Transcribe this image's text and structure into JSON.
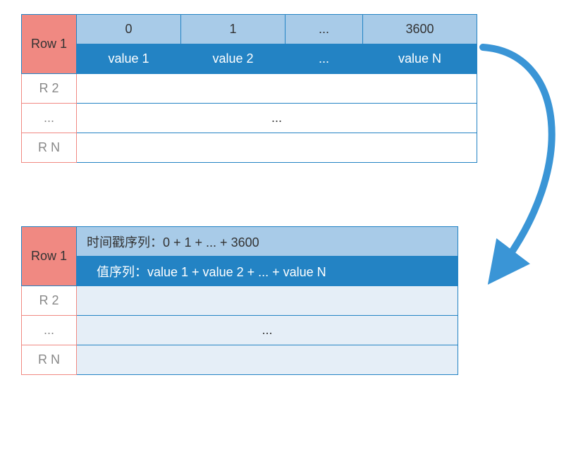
{
  "table1": {
    "row1_label": "Row 1",
    "headers": [
      "0",
      "1",
      "...",
      "3600"
    ],
    "values": [
      "value 1",
      "value 2",
      "...",
      "value N"
    ],
    "rows_below": [
      "R 2",
      "...",
      "R N"
    ],
    "ellipsis": "..."
  },
  "table2": {
    "row1_label": "Row 1",
    "timestamp_line": "时间戳序列：0 + 1 + ... + 3600",
    "value_line": "值序列：value 1 + value 2 + ... + value N",
    "rows_below": [
      "R 2",
      "...",
      "R N"
    ],
    "ellipsis": "..."
  },
  "colors": {
    "rowhead": "#f08982",
    "light_blue": "#a8cbe8",
    "mid_blue": "#2383c4",
    "pale_blue": "#e5eef7",
    "arrow": "#3a95d6"
  }
}
